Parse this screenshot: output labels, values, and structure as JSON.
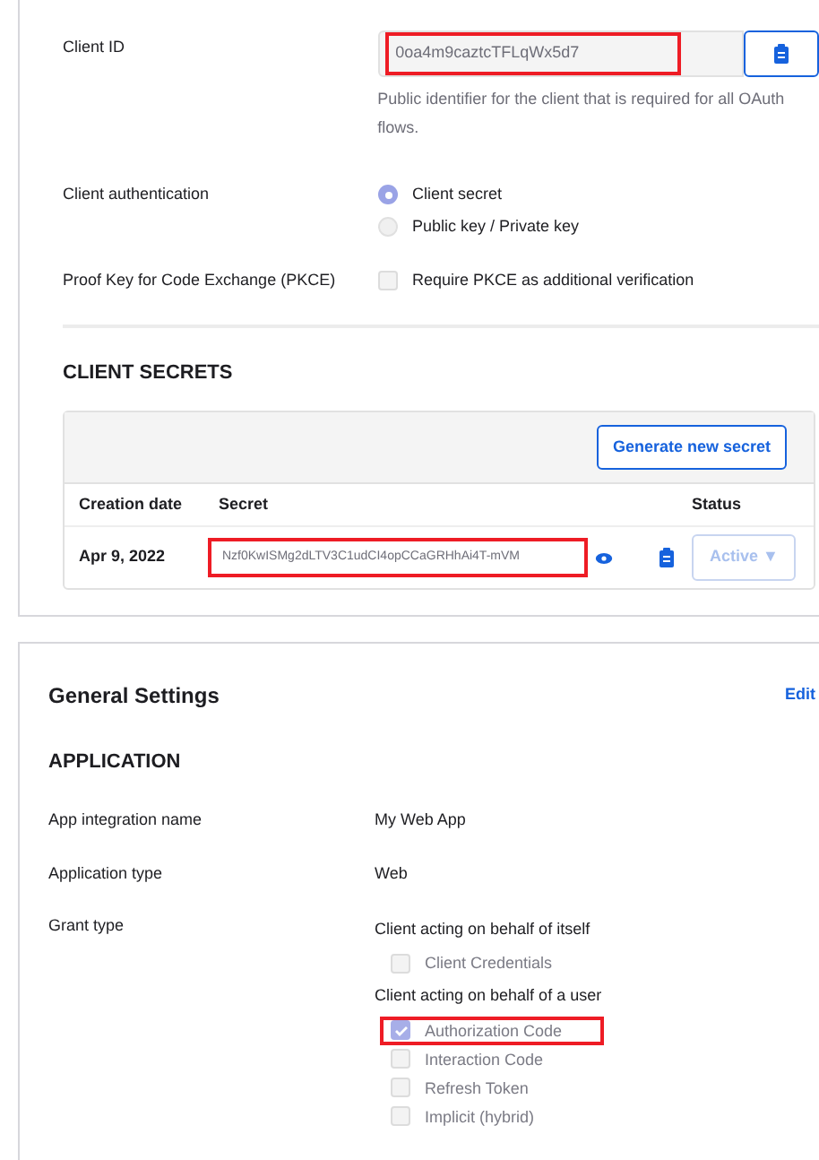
{
  "client_credentials": {
    "client_id": {
      "label": "Client ID",
      "value": "0oa4m9caztcTFLqWx5d7",
      "highlighted": true,
      "help": "Public identifier for the client that is required for all OAuth flows."
    },
    "client_authentication": {
      "label": "Client authentication",
      "options": [
        {
          "label": "Client secret",
          "selected": true
        },
        {
          "label": "Public key / Private key",
          "selected": false
        }
      ]
    },
    "pkce": {
      "label": "Proof Key for Code Exchange (PKCE)",
      "option": "Require PKCE as additional verification",
      "checked": false
    }
  },
  "client_secrets": {
    "title": "CLIENT SECRETS",
    "generate_button": "Generate new secret",
    "columns": [
      "Creation date",
      "Secret",
      "Status"
    ],
    "rows": [
      {
        "creation_date": "Apr 9, 2022",
        "secret": "Nzf0KwISMg2dLTV3C1udCI4opCCaGRHhAi4T-mVM",
        "highlighted": true,
        "status": "Active ▼"
      }
    ]
  },
  "general_settings": {
    "title": "General Settings",
    "edit": "Edit",
    "section": "APPLICATION",
    "fields": [
      {
        "label": "App integration name",
        "value": "My Web App"
      },
      {
        "label": "Application type",
        "value": "Web"
      }
    ],
    "grant_type": {
      "label": "Grant type",
      "groups": [
        {
          "title": "Client acting on behalf of itself",
          "options": [
            {
              "label": "Client Credentials",
              "checked": false,
              "highlighted": false
            }
          ]
        },
        {
          "title": "Client acting on behalf of a user",
          "options": [
            {
              "label": "Authorization Code",
              "checked": true,
              "highlighted": true
            },
            {
              "label": "Interaction Code",
              "checked": false,
              "highlighted": false
            },
            {
              "label": "Refresh Token",
              "checked": false,
              "highlighted": false
            },
            {
              "label": "Implicit (hybrid)",
              "checked": false,
              "highlighted": false
            }
          ]
        }
      ]
    }
  }
}
